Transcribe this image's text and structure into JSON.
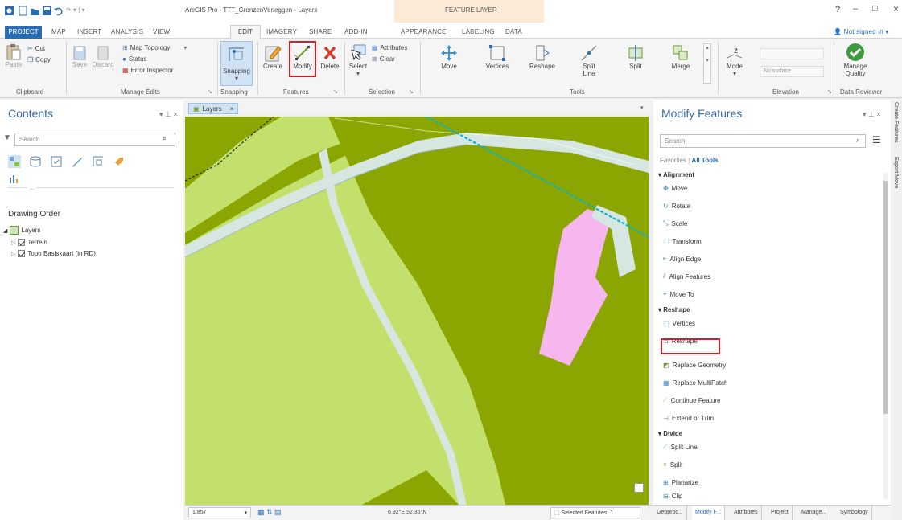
{
  "window": {
    "title": "ArcGIS Pro - TTT_GrenzenVerleggen - Layers",
    "contextual_tab_group": "FEATURE LAYER",
    "help": "?",
    "minimize": "–",
    "maximize": "□",
    "close": "×"
  },
  "ribbon_tabs": [
    "PROJECT",
    "MAP",
    "INSERT",
    "ANALYSIS",
    "VIEW",
    "EDIT",
    "IMAGERY",
    "SHARE",
    "ADD-IN",
    "APPEARANCE",
    "LABELING",
    "DATA"
  ],
  "active_tab": "EDIT",
  "sign_in": "Not signed in ▾",
  "ribbon": {
    "clipboard": {
      "label": "Clipboard",
      "paste": "Paste",
      "cut": "Cut",
      "copy": "Copy"
    },
    "manage_edits": {
      "label": "Manage Edits",
      "save": "Save",
      "discard": "Discard",
      "map_topology": "Map Topology",
      "status": "Status",
      "error_inspector": "Error Inspector"
    },
    "snapping": {
      "label": "Snapping",
      "button": "Snapping"
    },
    "features": {
      "label": "Features",
      "create": "Create",
      "modify": "Modify",
      "delete": "Delete"
    },
    "selection": {
      "label": "Selection",
      "select": "Select",
      "attributes": "Attributes",
      "clear": "Clear"
    },
    "tools": {
      "label": "Tools",
      "move": "Move",
      "vertices": "Vertices",
      "reshape": "Reshape",
      "split_line": "Split Line",
      "split": "Split",
      "merge": "Merge"
    },
    "elevation": {
      "label": "Elevation",
      "mode": "Mode",
      "no_surface": "No surface"
    },
    "data_reviewer": {
      "label": "Data Reviewer",
      "manage_quality": "Manage Quality"
    }
  },
  "contents": {
    "title": "Contents",
    "search_placeholder": "Search",
    "drawing_order": "Drawing Order",
    "layers": [
      {
        "name": "Layers",
        "level": 0
      },
      {
        "name": "Terrein",
        "level": 1
      },
      {
        "name": "Topo Basiskaart (in RD)",
        "level": 1
      }
    ]
  },
  "map": {
    "tab_label": "Layers",
    "scale": "1:857",
    "coordinates": "6.92°E 52.36°N",
    "selected_features": "Selected Features: 1"
  },
  "modify_features": {
    "title": "Modify Features",
    "search_placeholder": "Search",
    "favorites": "Favorites",
    "all_tools": "All Tools",
    "groups": [
      {
        "name": "Alignment",
        "tools": [
          "Move",
          "Rotate",
          "Scale",
          "Transform",
          "Align Edge",
          "Align Features",
          "Move To"
        ]
      },
      {
        "name": "Reshape",
        "tools": [
          "Vertices",
          "Reshape",
          "Replace Geometry",
          "Replace MultiPatch",
          "Continue Feature",
          "Extend or Trim"
        ]
      },
      {
        "name": "Divide",
        "tools": [
          "Split Line",
          "Split",
          "Planarize",
          "Clip"
        ]
      }
    ]
  },
  "side_tabs": [
    "Create Features",
    "Export Move"
  ],
  "bottom_tabs": [
    "Geoproc...",
    "Modify F...",
    "Attributes",
    "Project",
    "Manage...",
    "Symbology"
  ],
  "colors": {
    "olive": "#8ba600",
    "light_green": "#c4e06c",
    "pink": "#f5b7ee",
    "path": "#d6e6e0",
    "accent": "#2a6cb2",
    "highlight": "#d21d2a"
  }
}
